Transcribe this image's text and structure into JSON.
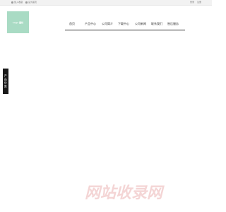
{
  "topbar": {
    "left_links": [
      "加入收藏",
      "设为首页"
    ],
    "right_links": [
      "登录",
      "注册"
    ]
  },
  "logo": {
    "text": "Logo 图标"
  },
  "nav": {
    "items": [
      "首页",
      "产品中心",
      "公司简介",
      "下载中心",
      "公司新闻",
      "联系我们",
      "售后服务"
    ]
  },
  "sidebar": {
    "tab_label": "产品分类"
  },
  "watermark": {
    "text": "网站收录网"
  },
  "colors": {
    "logo_bg": "#a9dbc4",
    "sidebar_bg": "#1a1a1a",
    "watermark": "#f4d5d5"
  }
}
